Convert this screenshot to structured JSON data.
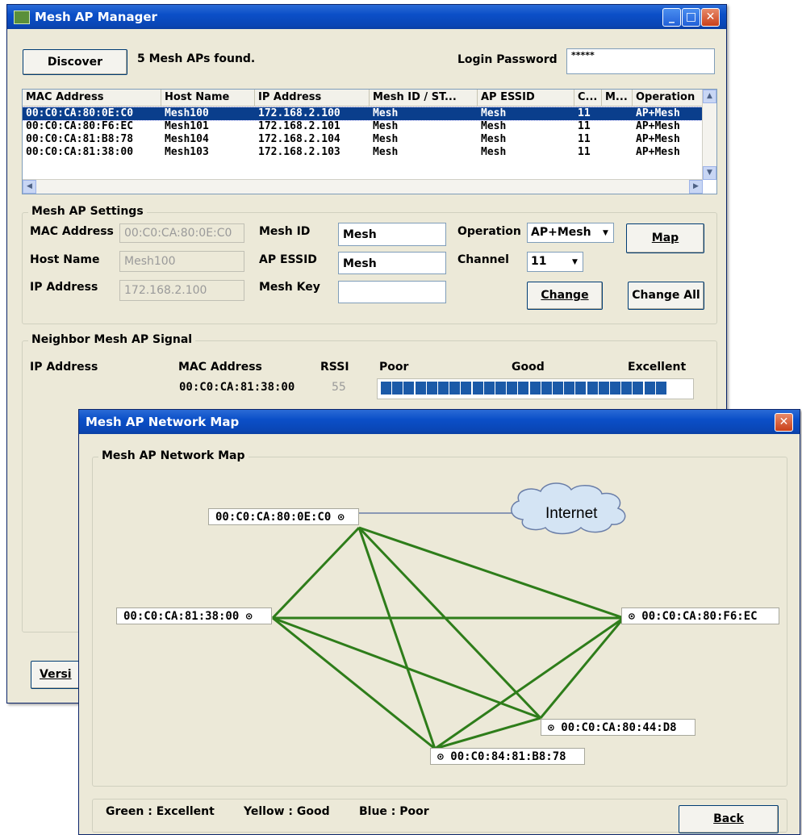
{
  "manager": {
    "title": "Mesh AP Manager",
    "discover_label": "Discover",
    "status": "5 Mesh APs found.",
    "password_label": "Login Password",
    "password_value": "*****",
    "columns": [
      "MAC Address",
      "Host Name",
      "IP Address",
      "Mesh ID / ST...",
      "AP ESSID",
      "C...",
      "M...",
      "Operation"
    ],
    "rows": [
      [
        "00:C0:CA:80:0E:C0",
        "Mesh100",
        "172.168.2.100",
        "Mesh",
        "Mesh",
        "11",
        "",
        "AP+Mesh"
      ],
      [
        "00:C0:CA:80:F6:EC",
        "Mesh101",
        "172.168.2.101",
        "Mesh",
        "Mesh",
        "11",
        "",
        "AP+Mesh"
      ],
      [
        "00:C0:CA:81:B8:78",
        "Mesh104",
        "172.168.2.104",
        "Mesh",
        "Mesh",
        "11",
        "",
        "AP+Mesh"
      ],
      [
        "00:C0:CA:81:38:00",
        "Mesh103",
        "172.168.2.103",
        "Mesh",
        "Mesh",
        "11",
        "",
        "AP+Mesh"
      ]
    ],
    "settings": {
      "group_title": "Mesh AP Settings",
      "mac_label": "MAC Address",
      "mac_value": "00:C0:CA:80:0E:C0",
      "host_label": "Host Name",
      "host_value": "Mesh100",
      "ip_label": "IP Address",
      "ip_value": "172.168.2.100",
      "meshid_label": "Mesh ID",
      "meshid_value": "Mesh",
      "essid_label": "AP ESSID",
      "essid_value": "Mesh",
      "meshkey_label": "Mesh Key",
      "meshkey_value": "",
      "operation_label": "Operation",
      "operation_value": "AP+Mesh",
      "channel_label": "Channel",
      "channel_value": "11",
      "map_label": "Map",
      "change_label": "Change",
      "change_all_label": "Change All"
    },
    "neighbor": {
      "group_title": "Neighbor Mesh AP Signal",
      "ip_header": "IP Address",
      "mac_header": "MAC Address",
      "rssi_header": "RSSI",
      "poor": "Poor",
      "good": "Good",
      "excellent": "Excellent",
      "mac": "00:C0:CA:81:38:00",
      "rssi": "55",
      "signal_segments": 25
    },
    "version_label": "Versi"
  },
  "map": {
    "title": "Mesh AP Network Map",
    "group_title": "Mesh AP Network Map",
    "internet_label": "Internet",
    "nodes": {
      "n1": "00:C0:CA:80:0E:C0",
      "n2": "00:C0:CA:81:38:00",
      "n3": "00:C0:CA:80:F6:EC",
      "n4": "00:C0:CA:80:44:D8",
      "n5": "00:C0:84:81:B8:78"
    },
    "link_color": "#2e7d1a",
    "legend": {
      "green": "Green : Excellent",
      "yellow": "Yellow : Good",
      "blue": "Blue : Poor"
    },
    "back_label": "Back"
  },
  "colors": {
    "titlebar": "#0b4fc8",
    "selection": "#0a3e8c",
    "signal": "#1b5aa8"
  }
}
